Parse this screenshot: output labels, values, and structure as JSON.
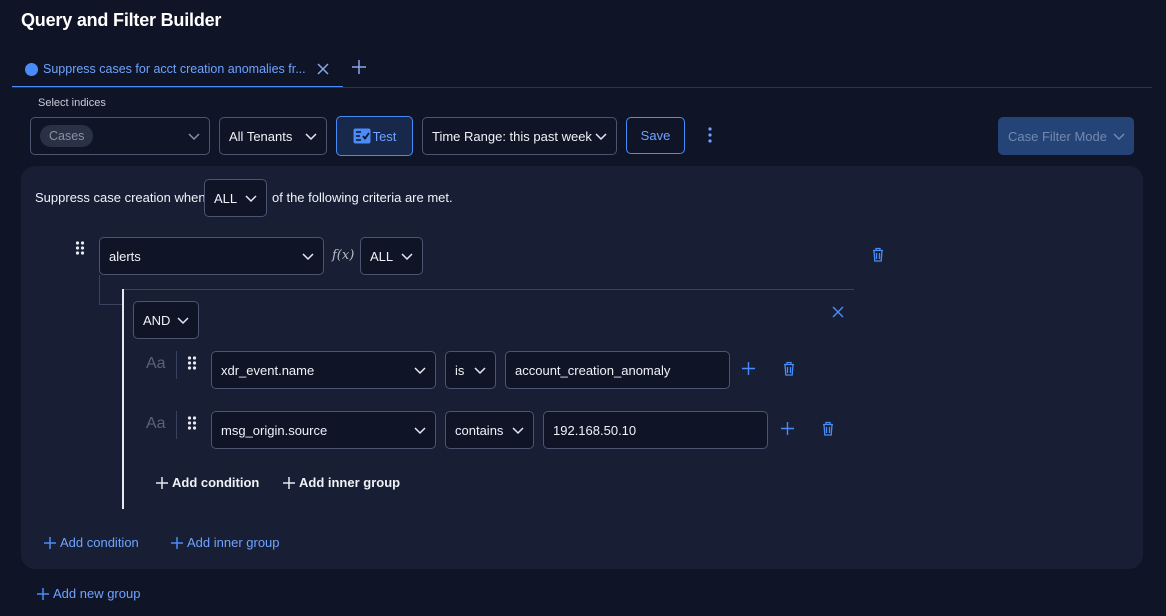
{
  "page_title": "Query and Filter Builder",
  "tab": {
    "label": "Suppress cases for acct creation anomalies fr..."
  },
  "toolbar": {
    "select_indices_label": "Select indices",
    "indices_chip": "Cases",
    "tenants_value": "All Tenants",
    "test_label": "Test",
    "time_range_value": "Time Range: this past week",
    "save_label": "Save",
    "mode_value": "Case Filter Mode"
  },
  "criteria": {
    "prefix": "Suppress case creation when",
    "match_value": "ALL",
    "suffix": "of the following criteria are met."
  },
  "group": {
    "field_value": "alerts",
    "fx_label": "f(x)",
    "fx_value": "ALL",
    "inner": {
      "operator_value": "AND",
      "conditions": [
        {
          "type_icon": "Aa",
          "field": "xdr_event.name",
          "op": "is",
          "value": "account_creation_anomaly"
        },
        {
          "type_icon": "Aa",
          "field": "msg_origin.source",
          "op": "contains",
          "value": "192.168.50.10"
        }
      ],
      "add_condition": "Add condition",
      "add_inner_group": "Add inner group"
    }
  },
  "outer_actions": {
    "add_condition": "Add condition",
    "add_inner_group": "Add inner group"
  },
  "add_new_group": "Add new group",
  "colors": {
    "accent": "#4a8cf7",
    "background": "#0f1527",
    "panel": "#181f34"
  }
}
